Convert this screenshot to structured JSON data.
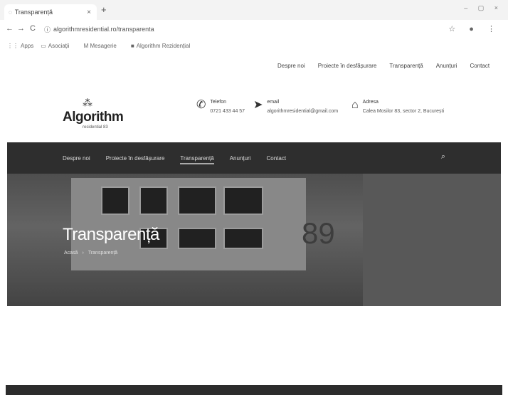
{
  "browser": {
    "tab_title": "Transparență",
    "url": "algorithmresidential.ro/transparenta",
    "bookmarks": [
      "Apps",
      "Asociații",
      "M Mesagerie",
      "Algorithm Rezidențial"
    ]
  },
  "site": {
    "top_menu": [
      "Despre noi",
      "Proiecte în desfășurare",
      "Transparență",
      "Anunțuri",
      "Contact"
    ],
    "logo": {
      "name": "Algorithm",
      "sub": "residential 83"
    },
    "contact": {
      "phone_label": "Telefon",
      "phone_value": "0721 433 44 57",
      "email_label": "email",
      "email_value": "algorithmresidential@gmail.com",
      "address_label": "Adresa",
      "address_value": "Calea Mosilor 83, sector 2, București"
    },
    "main_nav": [
      "Despre noi",
      "Proiecte în desfășurare",
      "Transparență",
      "Anunțuri",
      "Contact"
    ],
    "hero": {
      "title": "Transparență",
      "crumb_home": "Acasă",
      "crumb_current": "Transparență",
      "number": "89"
    }
  },
  "icons": {
    "phone": "phone-icon",
    "email": "send-icon",
    "address": "home-icon",
    "search": "search-icon"
  }
}
